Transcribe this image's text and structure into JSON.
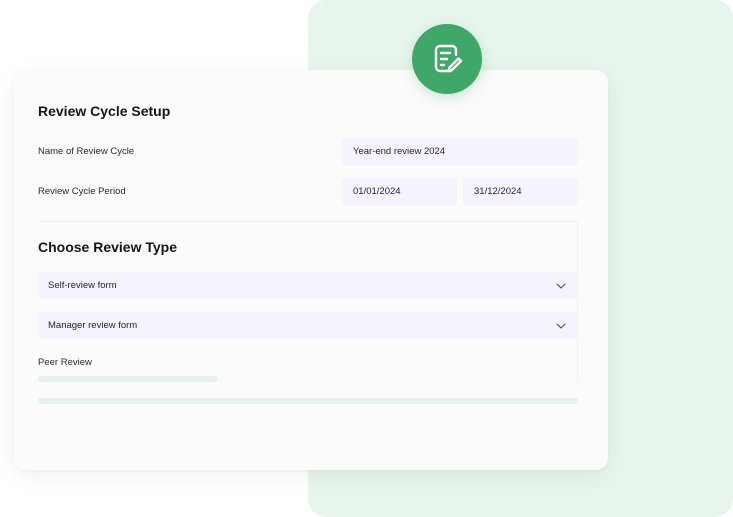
{
  "colors": {
    "accent_green": "#3fa868",
    "background_panel": "#e8f5ec",
    "field_background": "#f5f3fd"
  },
  "badge": {
    "icon": "edit-document-icon"
  },
  "setup": {
    "title": "Review Cycle Setup",
    "name_label": "Name of Review Cycle",
    "name_value": "Year-end review 2024",
    "period_label": "Review Cycle Period",
    "period_start": "01/01/2024",
    "period_end": "31/12/2024"
  },
  "review_type": {
    "title": "Choose Review Type",
    "options": [
      {
        "label": "Self-review form",
        "icon": "chevron-down-icon"
      },
      {
        "label": "Manager review form",
        "icon": "chevron-down-icon"
      }
    ],
    "peer_review_label": "Peer Review"
  }
}
